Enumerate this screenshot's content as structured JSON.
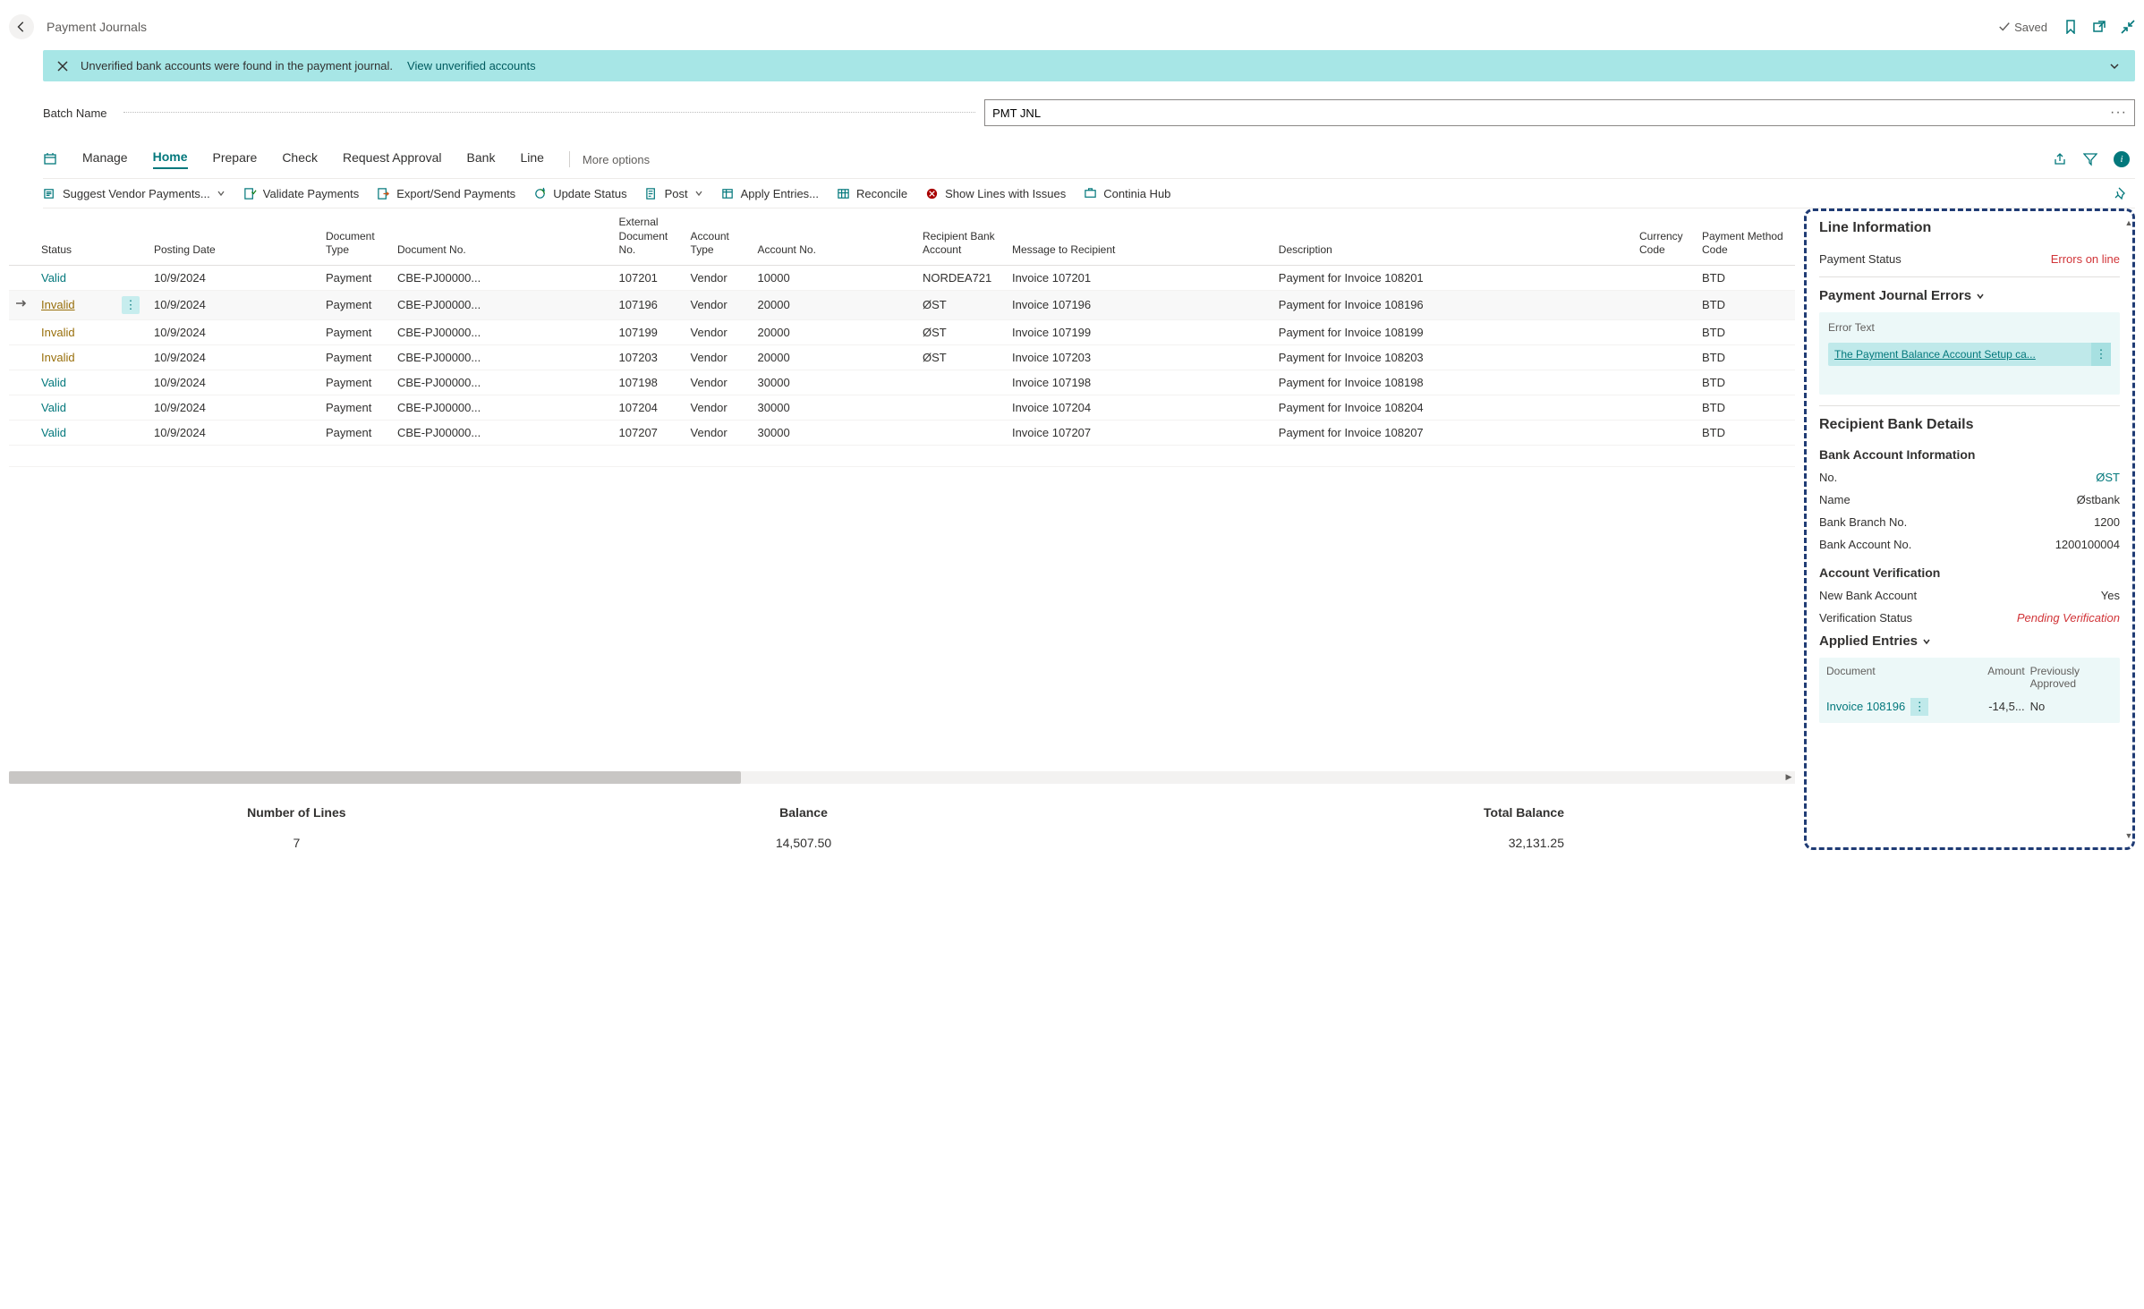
{
  "page": {
    "title": "Payment Journals",
    "saved_label": "Saved"
  },
  "notification": {
    "message": "Unverified bank accounts were found in the payment journal.",
    "link": "View unverified accounts"
  },
  "batch": {
    "label": "Batch Name",
    "value": "PMT JNL"
  },
  "tabs": {
    "items": [
      "Manage",
      "Home",
      "Prepare",
      "Check",
      "Request Approval",
      "Bank",
      "Line"
    ],
    "active": "Home",
    "more": "More options"
  },
  "actions": {
    "suggest": "Suggest Vendor Payments...",
    "validate": "Validate Payments",
    "export": "Export/Send Payments",
    "update": "Update Status",
    "post": "Post",
    "apply": "Apply Entries...",
    "reconcile": "Reconcile",
    "issues": "Show Lines with Issues",
    "hub": "Continia Hub"
  },
  "table": {
    "headers": {
      "status": "Status",
      "posting_date": "Posting Date",
      "doc_type": "Document Type",
      "doc_no": "Document No.",
      "ext_doc_no": "External Document No.",
      "acct_type": "Account Type",
      "acct_no": "Account No.",
      "recip_bank": "Recipient Bank Account",
      "msg": "Message to Recipient",
      "desc": "Description",
      "curr": "Currency Code",
      "pmethod": "Payment Method Code"
    },
    "rows": [
      {
        "status": "Valid",
        "posting": "10/9/2024",
        "dtype": "Payment",
        "dno": "CBE-PJ00000...",
        "ext": "107201",
        "atype": "Vendor",
        "ano": "10000",
        "bank": "NORDEA721",
        "msg": "Invoice 107201",
        "desc": "Payment for Invoice 108201",
        "curr": "",
        "pm": "BTD",
        "selected": false
      },
      {
        "status": "Invalid",
        "posting": "10/9/2024",
        "dtype": "Payment",
        "dno": "CBE-PJ00000...",
        "ext": "107196",
        "atype": "Vendor",
        "ano": "20000",
        "bank": "ØST",
        "msg": "Invoice 107196",
        "desc": "Payment for Invoice 108196",
        "curr": "",
        "pm": "BTD",
        "selected": true
      },
      {
        "status": "Invalid",
        "posting": "10/9/2024",
        "dtype": "Payment",
        "dno": "CBE-PJ00000...",
        "ext": "107199",
        "atype": "Vendor",
        "ano": "20000",
        "bank": "ØST",
        "msg": "Invoice 107199",
        "desc": "Payment for Invoice 108199",
        "curr": "",
        "pm": "BTD",
        "selected": false
      },
      {
        "status": "Invalid",
        "posting": "10/9/2024",
        "dtype": "Payment",
        "dno": "CBE-PJ00000...",
        "ext": "107203",
        "atype": "Vendor",
        "ano": "20000",
        "bank": "ØST",
        "msg": "Invoice 107203",
        "desc": "Payment for Invoice 108203",
        "curr": "",
        "pm": "BTD",
        "selected": false
      },
      {
        "status": "Valid",
        "posting": "10/9/2024",
        "dtype": "Payment",
        "dno": "CBE-PJ00000...",
        "ext": "107198",
        "atype": "Vendor",
        "ano": "30000",
        "bank": "",
        "msg": "Invoice 107198",
        "desc": "Payment for Invoice 108198",
        "curr": "",
        "pm": "BTD",
        "selected": false
      },
      {
        "status": "Valid",
        "posting": "10/9/2024",
        "dtype": "Payment",
        "dno": "CBE-PJ00000...",
        "ext": "107204",
        "atype": "Vendor",
        "ano": "30000",
        "bank": "",
        "msg": "Invoice 107204",
        "desc": "Payment for Invoice 108204",
        "curr": "",
        "pm": "BTD",
        "selected": false
      },
      {
        "status": "Valid",
        "posting": "10/9/2024",
        "dtype": "Payment",
        "dno": "CBE-PJ00000...",
        "ext": "107207",
        "atype": "Vendor",
        "ano": "30000",
        "bank": "",
        "msg": "Invoice 107207",
        "desc": "Payment for Invoice 108207",
        "curr": "",
        "pm": "BTD",
        "selected": false
      }
    ]
  },
  "summary": {
    "lines_label": "Number of Lines",
    "lines_value": "7",
    "balance_label": "Balance",
    "balance_value": "14,507.50",
    "total_label": "Total Balance",
    "total_value": "32,131.25"
  },
  "side": {
    "title": "Line Information",
    "pay_status_label": "Payment Status",
    "pay_status_value": "Errors on line",
    "errors_title": "Payment Journal Errors",
    "error_text_label": "Error Text",
    "error_text_value": "The Payment Balance Account Setup ca...",
    "bank_title": "Recipient Bank Details",
    "bank_info_title": "Bank Account Information",
    "bank_no_label": "No.",
    "bank_no_value": "ØST",
    "bank_name_label": "Name",
    "bank_name_value": "Østbank",
    "branch_label": "Bank Branch No.",
    "branch_value": "1200",
    "acct_label": "Bank Account No.",
    "acct_value": "1200100004",
    "verify_title": "Account Verification",
    "new_acct_label": "New Bank Account",
    "new_acct_value": "Yes",
    "vstatus_label": "Verification Status",
    "vstatus_value": "Pending Verification",
    "applied_title": "Applied Entries",
    "applied_headers": {
      "doc": "Document",
      "amount": "Amount",
      "approved": "Previously Approved"
    },
    "applied_row": {
      "doc": "Invoice 108196",
      "amount": "-14,5...",
      "approved": "No"
    }
  }
}
